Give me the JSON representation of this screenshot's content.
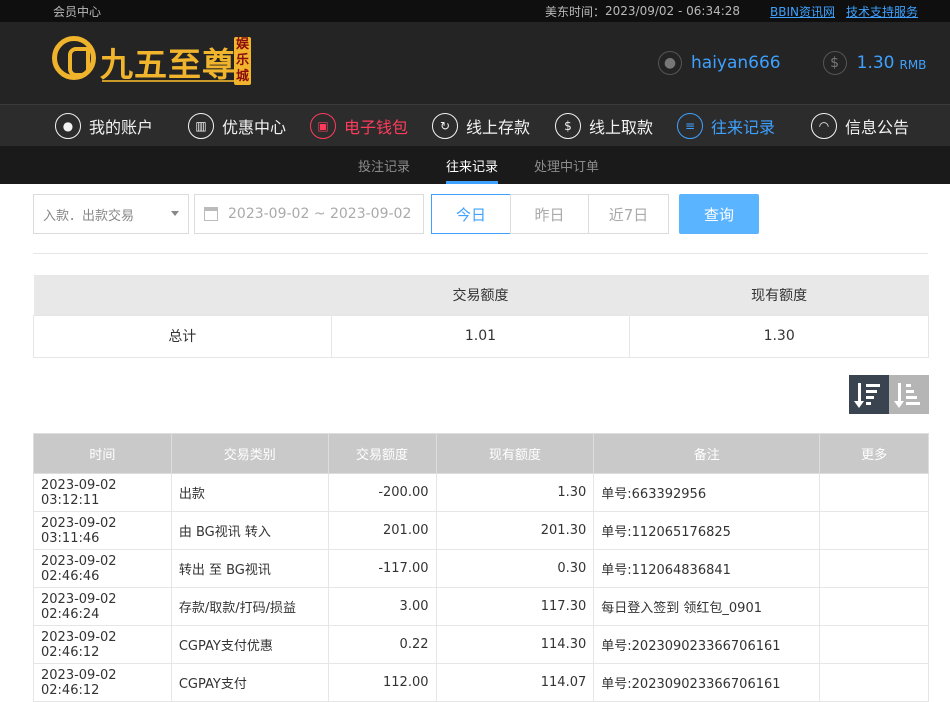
{
  "topbar": {
    "member_center": "会员中心",
    "time_label": "美东时间：",
    "time_value": "2023/09/02 - 06:34:28",
    "links": [
      "BBIN资讯网",
      "技术支持服务"
    ]
  },
  "header": {
    "logo_text": "九五至尊",
    "logo_badge": "娱乐城",
    "username": "haiyan666",
    "balance": "1.30",
    "currency": "RMB"
  },
  "nav": [
    {
      "label": "我的账户",
      "icon": "user-icon"
    },
    {
      "label": "优惠中心",
      "icon": "gift-icon"
    },
    {
      "label": "电子钱包",
      "icon": "wallet-icon"
    },
    {
      "label": "线上存款",
      "icon": "deposit-icon"
    },
    {
      "label": "线上取款",
      "icon": "withdraw-icon"
    },
    {
      "label": "往来记录",
      "icon": "records-icon"
    },
    {
      "label": "信息公告",
      "icon": "bell-icon"
    }
  ],
  "subtabs": [
    "投注记录",
    "往来记录",
    "处理中订单"
  ],
  "filters": {
    "type_select": "入款．出款交易",
    "date_range": "2023-09-02 ~ 2023-09-02",
    "quick": [
      "今日",
      "昨日",
      "近7日"
    ],
    "query_button": "查询"
  },
  "summary": {
    "headers": [
      "",
      "交易额度",
      "现有额度"
    ],
    "row": [
      "总计",
      "1.01",
      "1.30"
    ]
  },
  "records": {
    "headers": [
      "时间",
      "交易类别",
      "交易额度",
      "现有额度",
      "备注",
      "更多"
    ],
    "rows": [
      [
        "2023-09-02 03:12:11",
        "出款",
        "-200.00",
        "1.30",
        "单号:663392956",
        ""
      ],
      [
        "2023-09-02 03:11:46",
        "由 BG视讯 转入",
        "201.00",
        "201.30",
        "单号:112065176825",
        ""
      ],
      [
        "2023-09-02 02:46:46",
        "转出 至 BG视讯",
        "-117.00",
        "0.30",
        "单号:112064836841",
        ""
      ],
      [
        "2023-09-02 02:46:24",
        "存款/取款/打码/损益",
        "3.00",
        "117.30",
        "每日登入签到 领红包_0901",
        ""
      ],
      [
        "2023-09-02 02:46:12",
        "CGPAY支付优惠",
        "0.22",
        "114.30",
        "单号:202309023366706161",
        ""
      ],
      [
        "2023-09-02 02:46:12",
        "CGPAY支付",
        "112.00",
        "114.07",
        "单号:202309023366706161",
        ""
      ]
    ]
  },
  "colors": {
    "accent": "#3ea1ff",
    "wallet_red": "#ff3b5c",
    "logo_gold": "#f1b52d"
  }
}
